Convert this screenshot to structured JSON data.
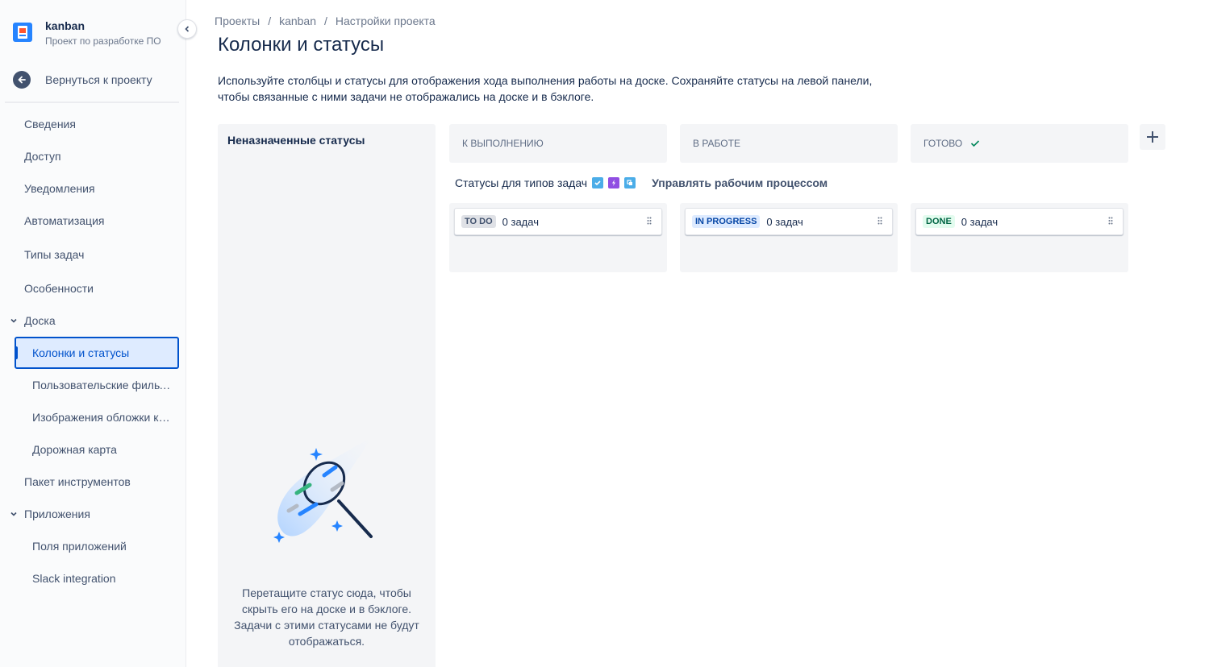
{
  "project": {
    "name": "kanban",
    "type": "Проект по разработке ПО"
  },
  "sidebar": {
    "back_label": "Вернуться к проекту",
    "items": [
      {
        "label": "Сведения"
      },
      {
        "label": "Доступ"
      },
      {
        "label": "Уведомления"
      },
      {
        "label": "Автоматизация"
      },
      {
        "label": "Типы задач"
      },
      {
        "label": "Особенности"
      }
    ],
    "board_group": "Доска",
    "board_items": [
      {
        "label": "Колонки и статусы",
        "active": true
      },
      {
        "label": "Пользовательские фильтры"
      },
      {
        "label": "Изображения обложки карточек"
      },
      {
        "label": "Дорожная карта"
      }
    ],
    "toolkit": "Пакет инструментов",
    "apps_group": "Приложения",
    "apps_items": [
      {
        "label": "Поля приложений"
      },
      {
        "label": "Slack integration"
      }
    ]
  },
  "breadcrumbs": [
    "Проекты",
    "kanban",
    "Настройки проекта"
  ],
  "page_title": "Колонки и статусы",
  "description": "Используйте столбцы и статусы для отображения хода выполнения работы на доске. Сохраняйте статусы на левой панели, чтобы связанные с ними задачи не отображались на доске и в бэклоге.",
  "unassigned": {
    "title": "Неназначенные статусы",
    "hint": "Перетащите статус сюда, чтобы скрыть его на доске и в бэклоге. Задачи с этими статусами не будут отображаться."
  },
  "issue_types_label": "Статусы для типов задач",
  "manage_workflow_label": "Управлять рабочим процессом",
  "columns": [
    {
      "name": "К выполнению",
      "status": "TO DO",
      "count": "0 задач"
    },
    {
      "name": "В работе",
      "status": "IN PROGRESS",
      "count": "0 задач"
    },
    {
      "name": "Готово",
      "status": "DONE",
      "count": "0 задач"
    }
  ],
  "colors": {
    "accent": "#0052cc",
    "todo": "#dfe1e6",
    "in_progress": "#deebff",
    "done": "#e3fcef"
  },
  "icons": [
    "chevron-left-icon",
    "back-arrow-icon",
    "chevron-down-icon",
    "checkmark-icon",
    "plus-icon",
    "drag-handle-icon",
    "task-icon",
    "epic-icon",
    "subtask-icon"
  ]
}
